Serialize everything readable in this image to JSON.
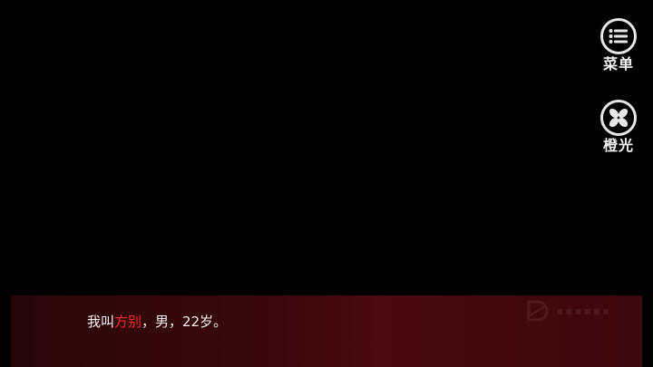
{
  "sidebar": {
    "menu_label": "菜单",
    "light_label": "橙光"
  },
  "dialog": {
    "text_before": "我叫",
    "highlight": "方别",
    "text_after": "，男，22岁。",
    "highlight_color": "#ff2a2a"
  }
}
